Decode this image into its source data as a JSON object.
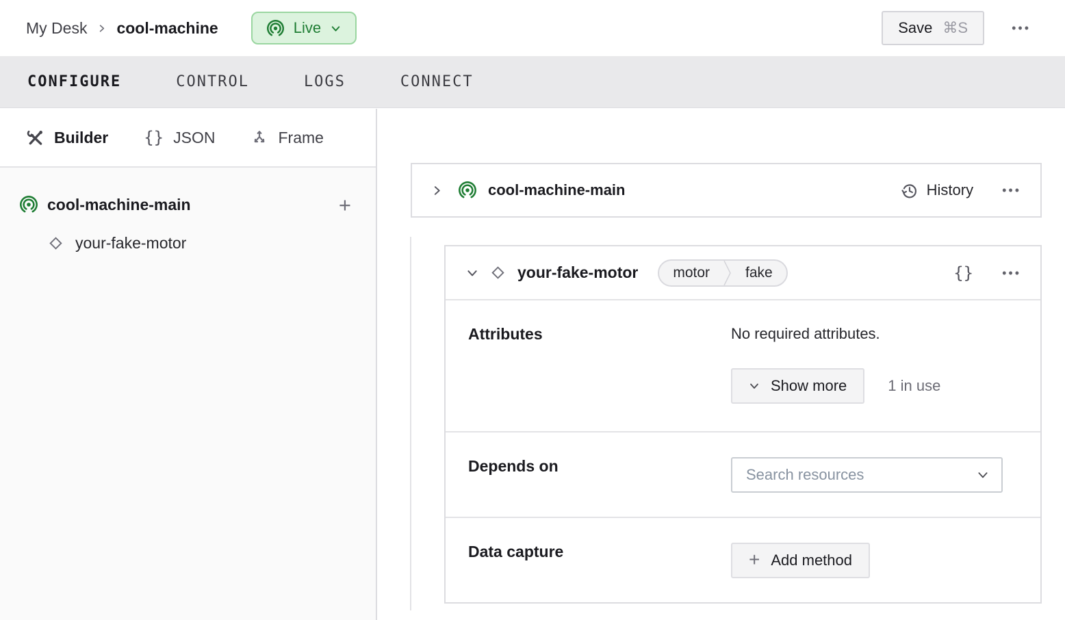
{
  "header": {
    "breadcrumb": {
      "parent": "My Desk",
      "current": "cool-machine"
    },
    "live": {
      "label": "Live"
    },
    "save": {
      "label": "Save",
      "shortcut": "⌘S"
    }
  },
  "tabs": [
    {
      "label": "CONFIGURE",
      "active": true
    },
    {
      "label": "CONTROL",
      "active": false
    },
    {
      "label": "LOGS",
      "active": false
    },
    {
      "label": "CONNECT",
      "active": false
    }
  ],
  "sidebar": {
    "views": [
      {
        "label": "Builder",
        "active": true
      },
      {
        "label": "JSON",
        "active": false
      },
      {
        "label": "Frame",
        "active": false
      }
    ],
    "tree": {
      "root": "cool-machine-main",
      "child": "your-fake-motor"
    }
  },
  "main": {
    "machine_card": {
      "title": "cool-machine-main",
      "history": "History"
    },
    "component_card": {
      "title": "your-fake-motor",
      "badges": {
        "type": "motor",
        "model": "fake"
      },
      "attributes": {
        "label": "Attributes",
        "empty": "No required attributes.",
        "show_more": "Show more",
        "in_use": "1 in use"
      },
      "depends_on": {
        "label": "Depends on",
        "placeholder": "Search resources"
      },
      "data_capture": {
        "label": "Data capture",
        "add_method": "Add method"
      }
    }
  },
  "icons": {
    "braces": "{}",
    "dots": "•••",
    "plus": "+"
  },
  "colors": {
    "accent_green": "#1e7d33",
    "live_bg": "#dcf3de",
    "live_border": "#9ad6a0",
    "tab_bar_bg": "#e9e9eb",
    "card_border": "#dcdce0",
    "muted_text": "#6b6b74"
  }
}
